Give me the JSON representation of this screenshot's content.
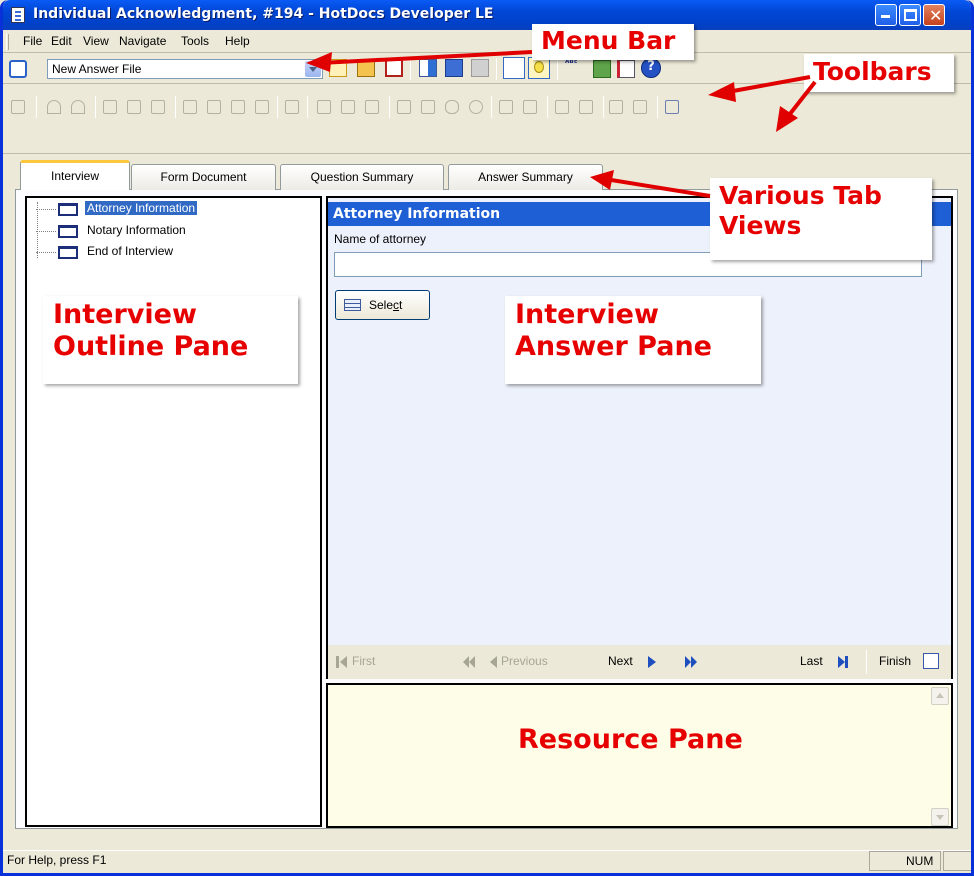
{
  "window": {
    "title": "Individual Acknowledgment, #194 - HotDocs Developer LE",
    "buttons": {
      "minimize": "_",
      "maximize": "□",
      "close": "✕"
    }
  },
  "menubar": {
    "items": [
      "File",
      "Edit",
      "View",
      "Navigate",
      "Tools",
      "Help"
    ]
  },
  "toolbar": {
    "answer_file_value": "New Answer File"
  },
  "tabs": [
    {
      "label": "Interview",
      "active": true
    },
    {
      "label": "Form Document",
      "active": false
    },
    {
      "label": "Question Summary",
      "active": false
    },
    {
      "label": "Answer Summary",
      "active": false
    }
  ],
  "outline": {
    "items": [
      {
        "label": "Attorney Information",
        "selected": true
      },
      {
        "label": "Notary Information",
        "selected": false
      },
      {
        "label": "End of Interview",
        "selected": false
      }
    ]
  },
  "answer": {
    "header": "Attorney Information",
    "field_label": "Name of attorney",
    "field_value": "",
    "select_label_pre": "Sele",
    "select_label_ul": "c",
    "select_label_post": "t"
  },
  "navigation": {
    "first": "First",
    "previous": "Previous",
    "next": "Next",
    "last": "Last",
    "finish": "Finish"
  },
  "status": {
    "help_text": "For Help, press F1",
    "num": "NUM"
  },
  "annotations": {
    "menu_bar": "Menu Bar",
    "toolbars": "Toolbars",
    "tab_views_line1": "Various Tab",
    "tab_views_line2": "Views",
    "outline_line1": "Interview",
    "outline_line2": "Outline Pane",
    "answer_line1": "Interview",
    "answer_line2": "Answer Pane",
    "resource": "Resource Pane"
  },
  "colors": {
    "annotation_red": "#e60000",
    "titlebar_blue": "#0046d5",
    "question_header": "#1f5fd6",
    "answer_bg": "#edf1fb",
    "resource_bg": "#fdfde8"
  }
}
